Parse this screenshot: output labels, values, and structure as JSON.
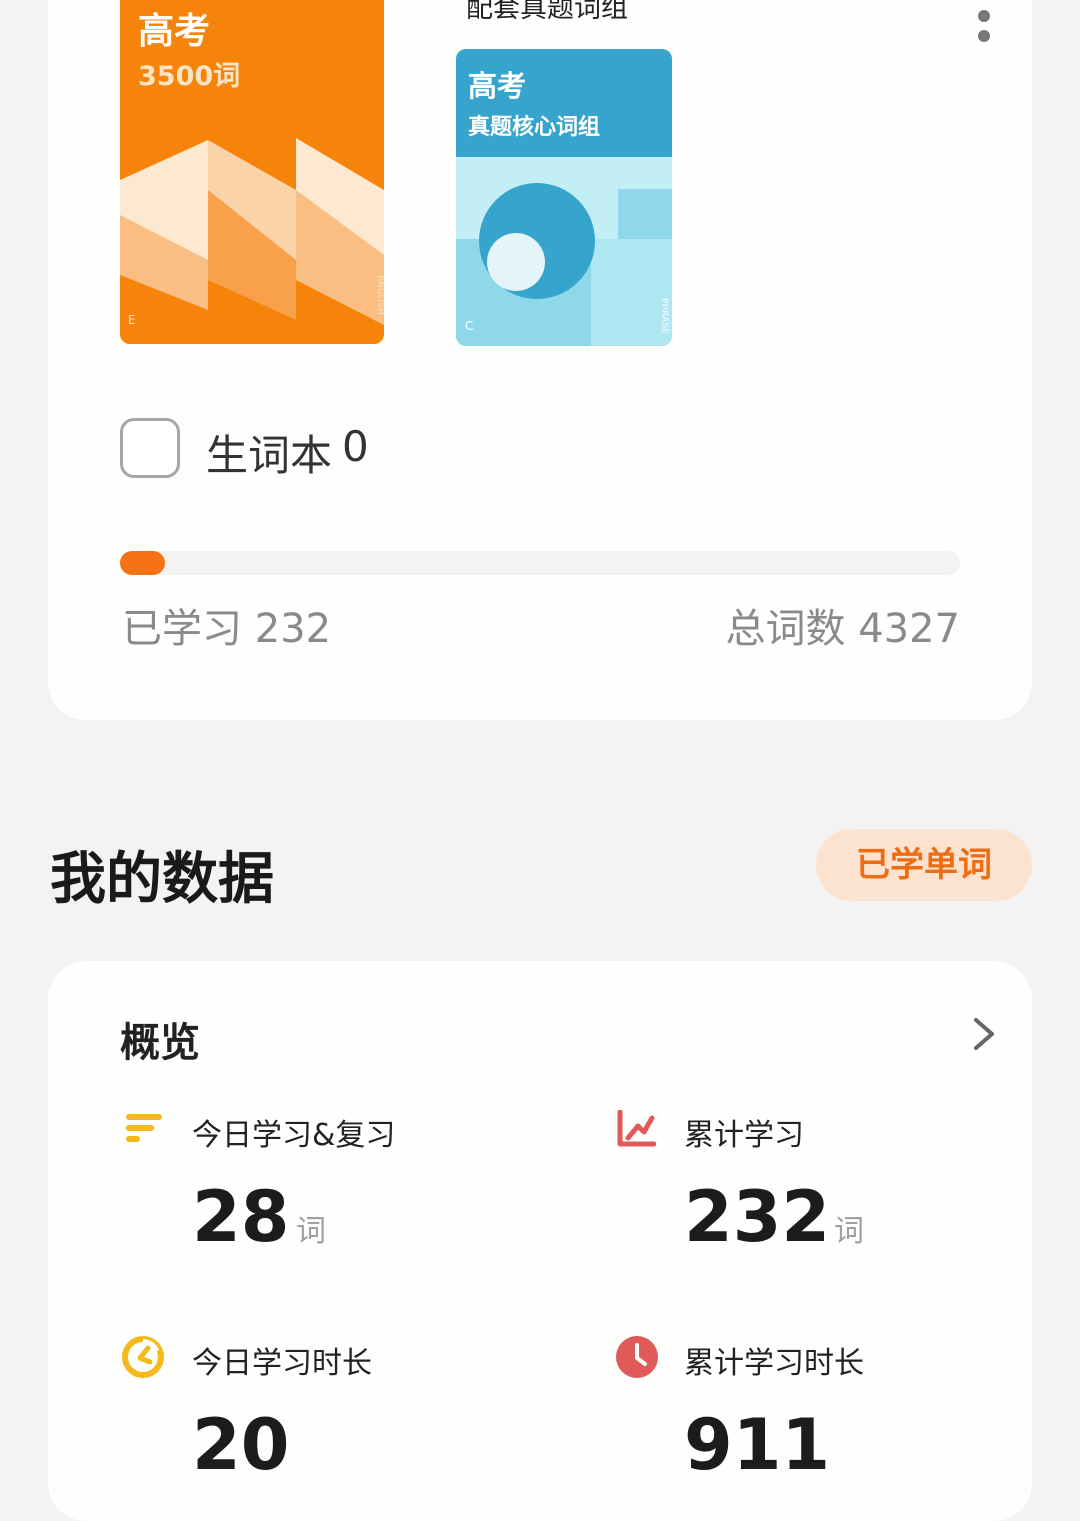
{
  "book": {
    "cover_title": "高考",
    "cover_subtitle": "3500词",
    "cover_letter": "E",
    "cover_spine": "ENGLISH",
    "colors": {
      "accent": "#f7840a"
    }
  },
  "companion_book": {
    "caption": "配套真题词组",
    "cover_title": "高考",
    "cover_subtitle": "真题核心词组",
    "cover_letter": "C",
    "cover_spine": "PHRASE",
    "colors": {
      "header": "#36a4cd",
      "body": "#c3eef5"
    }
  },
  "vocab_book": {
    "label": "生词本",
    "count": "0"
  },
  "progress": {
    "fraction": 0.0536,
    "learned_text": "已学习 232",
    "total_text": "总词数 4327"
  },
  "section": {
    "title": "我的数据",
    "button_label": "已学单词"
  },
  "overview": {
    "title": "概览",
    "stats": [
      {
        "icon": "bars-icon",
        "label": "今日学习&复习",
        "value": "28",
        "unit": "词",
        "color": "#f5b91a"
      },
      {
        "icon": "line-chart-icon",
        "label": "累计学习",
        "value": "232",
        "unit": "词",
        "color": "#e05a5a"
      },
      {
        "icon": "half-clock-icon",
        "label": "今日学习时长",
        "value": "20",
        "unit": "",
        "color": "#f5b91a"
      },
      {
        "icon": "clock-icon",
        "label": "累计学习时长",
        "value": "911",
        "unit": "",
        "color": "#e05a5a"
      }
    ]
  }
}
